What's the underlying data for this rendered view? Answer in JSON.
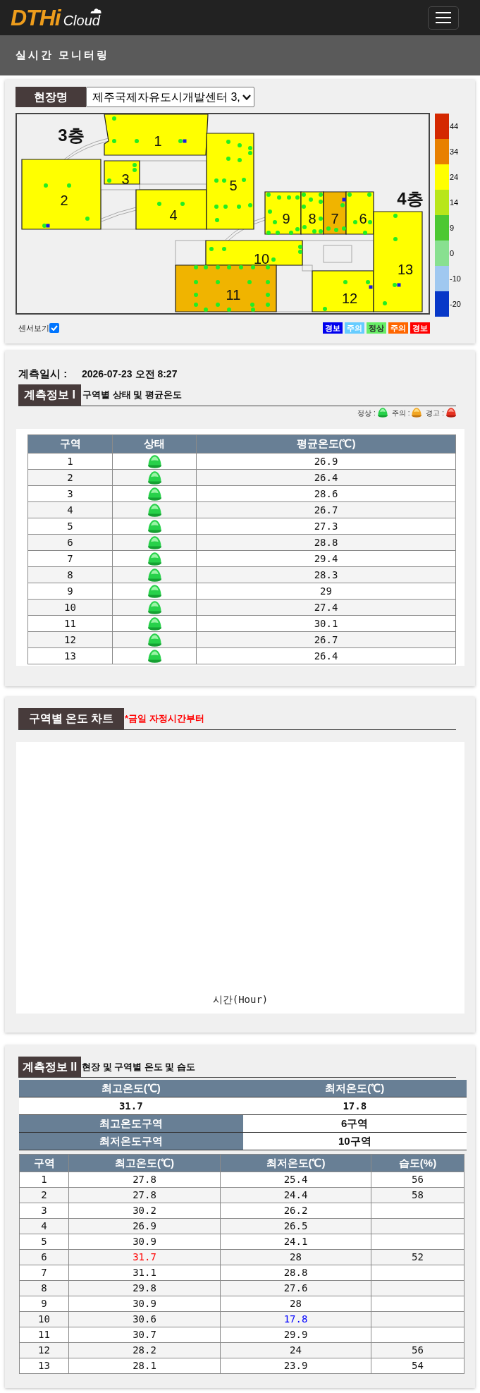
{
  "header": {
    "logo": {
      "primary": "DTHi",
      "secondary": "Cloud"
    }
  },
  "page_title": "실시간 모니터링",
  "site": {
    "label": "현장명",
    "value": "제주국제자유도시개발센터 3,"
  },
  "map": {
    "floors": [
      {
        "label": "3층"
      },
      {
        "label": "4층"
      }
    ],
    "zones": [
      {
        "label": "1",
        "color": "#ffff00"
      },
      {
        "label": "2",
        "color": "#ffff00"
      },
      {
        "label": "3",
        "color": "#ffff00"
      },
      {
        "label": "4",
        "color": "#ffff00"
      },
      {
        "label": "5",
        "color": "#ffff00"
      },
      {
        "label": "9",
        "color": "#ffff00"
      },
      {
        "label": "8",
        "color": "#ffff00"
      },
      {
        "label": "7",
        "color": "#f0b400"
      },
      {
        "label": "6",
        "color": "#ffff00"
      },
      {
        "label": "10",
        "color": "#ffff00"
      },
      {
        "label": "11",
        "color": "#f0b400"
      },
      {
        "label": "12",
        "color": "#ffff00"
      },
      {
        "label": "13",
        "color": "#ffff00"
      }
    ],
    "scale": [
      {
        "label": "44",
        "color": "#d42800"
      },
      {
        "label": "34",
        "color": "#e88000"
      },
      {
        "label": "24",
        "color": "#ffff00"
      },
      {
        "label": "14",
        "color": "#b8e61a"
      },
      {
        "label": "9",
        "color": "#4cc832"
      },
      {
        "label": "0",
        "color": "#88e090"
      },
      {
        "label": "-10",
        "color": "#a0c8f0"
      },
      {
        "label": "-20",
        "color": "#0838c8"
      }
    ],
    "sensor_toggle": {
      "label": "센서보기",
      "checked": true
    },
    "status_legend": [
      {
        "label": "경보",
        "color": "#0000ee"
      },
      {
        "label": "주의",
        "color": "#66ccff"
      },
      {
        "label": "정상",
        "color": "#66ee66"
      },
      {
        "label": "주의",
        "color": "#ff6600"
      },
      {
        "label": "경보",
        "color": "#ff0000"
      }
    ]
  },
  "measurement": {
    "label": "계측일시 :",
    "value": "2026-07-23 오전 8:27"
  },
  "section_1": {
    "title": "계측정보 I",
    "subtitle": "구역별 상태 및 평균온도",
    "legend": [
      {
        "label": "정상 :",
        "kind": "normal"
      },
      {
        "label": "주의 :",
        "kind": "caution"
      },
      {
        "label": "경고 :",
        "kind": "warning"
      }
    ],
    "table": {
      "columns": [
        "구역",
        "상태",
        "평균온도(℃)"
      ],
      "rows": [
        {
          "zone": "1",
          "kind": "normal",
          "average": "26.9"
        },
        {
          "zone": "2",
          "kind": "normal",
          "average": "26.4"
        },
        {
          "zone": "3",
          "kind": "normal",
          "average": "28.6"
        },
        {
          "zone": "4",
          "kind": "normal",
          "average": "26.7"
        },
        {
          "zone": "5",
          "kind": "normal",
          "average": "27.3"
        },
        {
          "zone": "6",
          "kind": "normal",
          "average": "28.8"
        },
        {
          "zone": "7",
          "kind": "normal",
          "average": "29.4"
        },
        {
          "zone": "8",
          "kind": "normal",
          "average": "28.3"
        },
        {
          "zone": "9",
          "kind": "normal",
          "average": "29"
        },
        {
          "zone": "10",
          "kind": "normal",
          "average": "27.4"
        },
        {
          "zone": "11",
          "kind": "normal",
          "average": "30.1"
        },
        {
          "zone": "12",
          "kind": "normal",
          "average": "26.7"
        },
        {
          "zone": "13",
          "kind": "normal",
          "average": "26.4"
        }
      ]
    }
  },
  "chart_section": {
    "title": "구역별 온도 차트",
    "note": "*금일 자정시간부터",
    "xlabel": "시간(Hour)"
  },
  "section_2": {
    "title": "계측정보 II",
    "subtitle": "현장 및 구역별 온도 및 습도",
    "summary": {
      "columns": [
        "최고온도(℃)",
        "최저온도(℃)"
      ],
      "values": [
        "31.7",
        "17.8"
      ],
      "rows": [
        {
          "label": "최고온도구역",
          "value": "6구역"
        },
        {
          "label": "최저온도구역",
          "value": "10구역"
        }
      ]
    },
    "table": {
      "columns": [
        "구역",
        "최고온도(℃)",
        "최저온도(℃)",
        "습도(%)"
      ],
      "rows": [
        {
          "zone": "1",
          "max": "27.8",
          "min": "25.4",
          "humidity": "56",
          "highest": false,
          "lowest": false
        },
        {
          "zone": "2",
          "max": "27.8",
          "min": "24.4",
          "humidity": "58",
          "highest": false,
          "lowest": false
        },
        {
          "zone": "3",
          "max": "30.2",
          "min": "26.2",
          "highest": false,
          "lowest": false
        },
        {
          "zone": "4",
          "max": "26.9",
          "min": "26.5",
          "highest": false,
          "lowest": false
        },
        {
          "zone": "5",
          "max": "30.9",
          "min": "24.1",
          "highest": false,
          "lowest": false
        },
        {
          "zone": "6",
          "max": "31.7",
          "min": "28",
          "humidity": "52",
          "highest": true,
          "lowest": false
        },
        {
          "zone": "7",
          "max": "31.1",
          "min": "28.8",
          "highest": false,
          "lowest": false
        },
        {
          "zone": "8",
          "max": "29.8",
          "min": "27.6",
          "highest": false,
          "lowest": false
        },
        {
          "zone": "9",
          "max": "30.9",
          "min": "28",
          "highest": false,
          "lowest": false
        },
        {
          "zone": "10",
          "max": "30.6",
          "min": "17.8",
          "highest": false,
          "lowest": true
        },
        {
          "zone": "11",
          "max": "30.7",
          "min": "29.9",
          "highest": false,
          "lowest": false
        },
        {
          "zone": "12",
          "max": "28.2",
          "min": "24",
          "humidity": "56",
          "highest": false,
          "lowest": false
        },
        {
          "zone": "13",
          "max": "28.1",
          "min": "23.9",
          "humidity": "54",
          "highest": false,
          "lowest": false
        }
      ]
    }
  }
}
